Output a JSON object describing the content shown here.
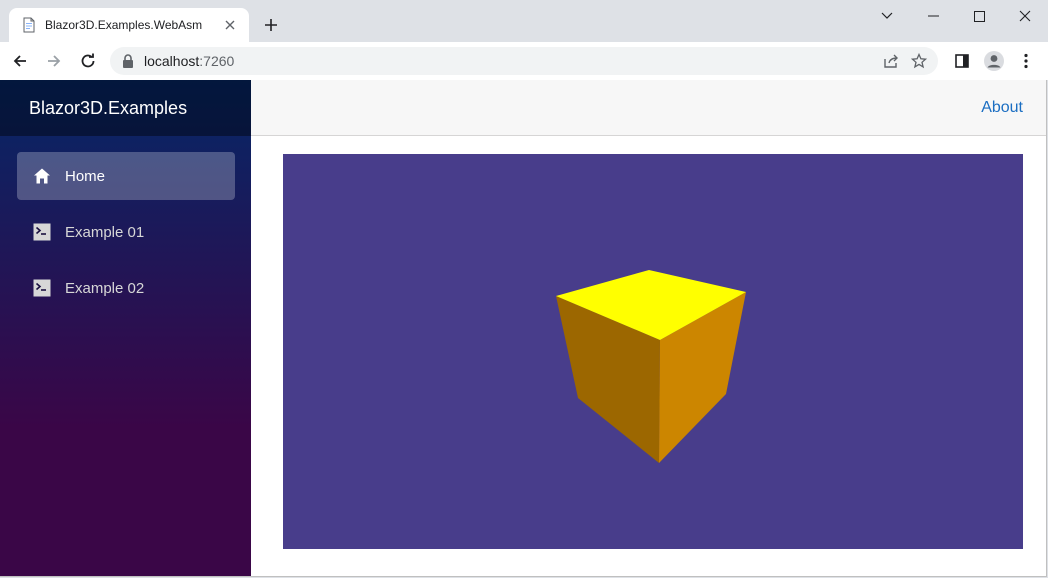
{
  "browser": {
    "tab": {
      "title": "Blazor3D.Examples.WebAsm",
      "close_icon": "close-icon"
    },
    "new_tab_label": "+",
    "address_bar": {
      "host": "localhost",
      "port": ":7260"
    }
  },
  "app": {
    "brand": "Blazor3D.Examples",
    "nav": [
      {
        "label": "Home",
        "icon": "home-icon",
        "active": true
      },
      {
        "label": "Example 01",
        "icon": "terminal-icon",
        "active": false
      },
      {
        "label": "Example 02",
        "icon": "terminal-icon",
        "active": false
      }
    ],
    "top_link": "About"
  },
  "scene": {
    "background": "#483d8b",
    "cube_colors": {
      "top": "#ffff00",
      "left": "#9c6700",
      "right": "#cc8600"
    }
  },
  "colors": {
    "sidebar_gradient_top": "#052767",
    "sidebar_gradient_bottom": "#3a0647",
    "link": "#1b6ec2"
  }
}
